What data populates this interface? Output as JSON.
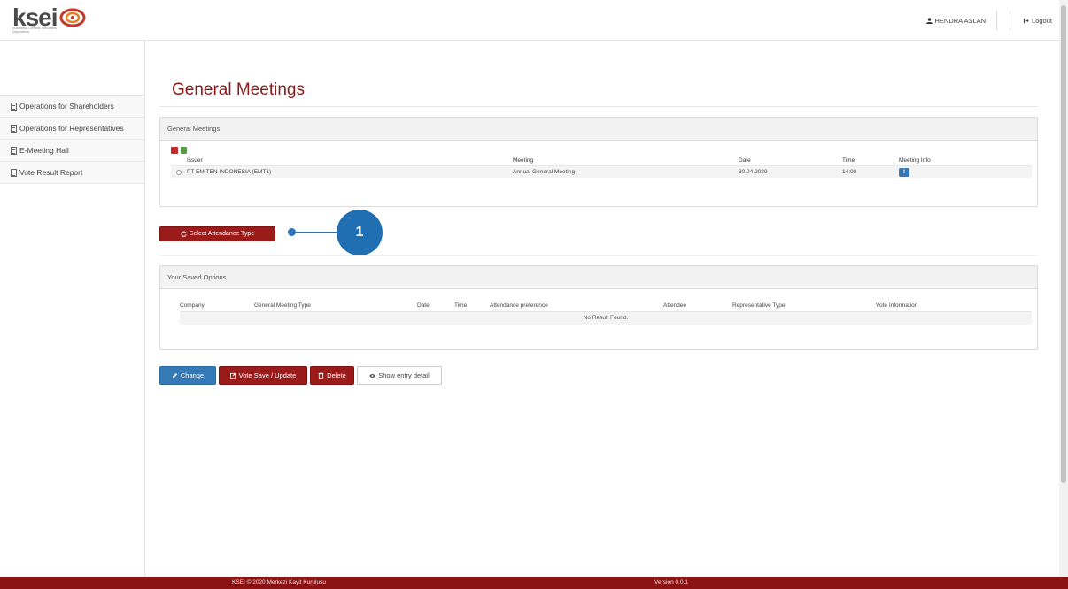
{
  "header": {
    "logo_text": "ksei",
    "logo_subtitle": "Indonesia Central Securities Depository",
    "user_name": "HENDRA ASLAN",
    "logout_label": "Logout"
  },
  "sidebar": {
    "items": [
      {
        "label": "Operations for Shareholders"
      },
      {
        "label": "Operations for Representatives"
      },
      {
        "label": "E-Meeting Hall"
      },
      {
        "label": "Vote Result Report"
      }
    ]
  },
  "main": {
    "title": "General Meetings",
    "general_meetings_panel": {
      "heading": "General Meetings",
      "columns": {
        "issuer": "Issuer",
        "meeting": "Meeting",
        "date": "Date",
        "time": "Time",
        "info": "Meeting Info"
      },
      "rows": [
        {
          "issuer": "PT EMITEN INDONESIA (EMT1)",
          "meeting": "Annual General Meeting",
          "date": "30.04.2020",
          "time": "14:00",
          "info_icon": "i"
        }
      ]
    },
    "select_attendance_label": "Select Attendance Type",
    "callout_number": "1",
    "saved_options_panel": {
      "heading": "Your Saved Options",
      "columns": {
        "company": "Company",
        "type": "General Meeting Type",
        "date": "Date",
        "time": "Time",
        "preference": "Attendance preference",
        "attendee": "Attendee",
        "rep_type": "Representative Type",
        "vote": "Vote Information"
      },
      "empty_message": "No Result Found."
    },
    "buttons": {
      "change": "Change",
      "vote": "Vote Save / Update",
      "delete": "Delete",
      "show": "Show entry detail"
    }
  },
  "footer": {
    "copyright": "KSEI © 2020 Merkezi Kayit Kurulusu",
    "version": "Version 0.0.1"
  },
  "colors": {
    "brand_red": "#9b1b1b",
    "title_red": "#8b1a1a",
    "action_blue": "#337ab7",
    "callout_blue": "#1f6fb2"
  }
}
